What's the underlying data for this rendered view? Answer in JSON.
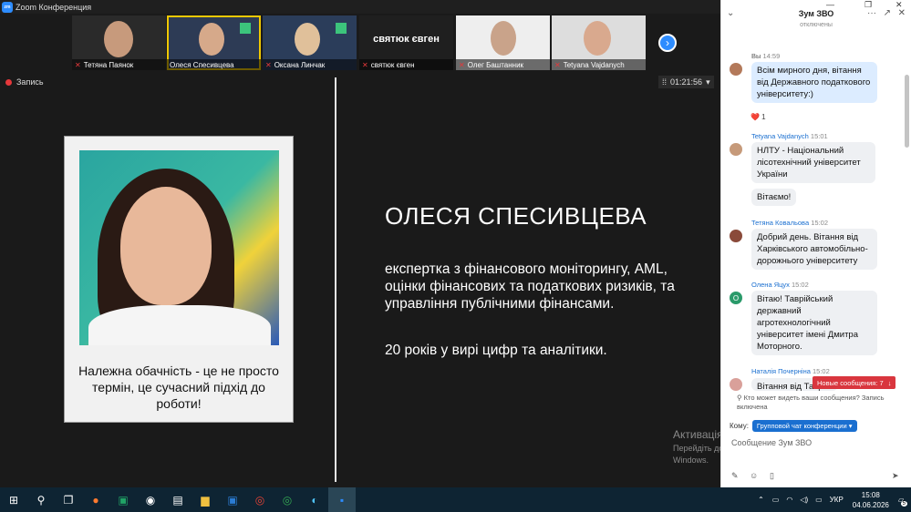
{
  "window": {
    "title": "Zoom Конференция",
    "logo": "zm"
  },
  "participants": [
    {
      "name": "Тетяна Паянок",
      "muted": true
    },
    {
      "name": "Олеся Спесивцева",
      "muted": false,
      "active": true
    },
    {
      "name": "Оксана Линчак",
      "muted": true
    },
    {
      "name": "святюк євген",
      "muted": true,
      "display_name": "святюк євген"
    },
    {
      "name": "Олег Баштанник",
      "muted": true
    },
    {
      "name": "Tetyana Vajdanych",
      "muted": true
    }
  ],
  "toolbar": {
    "record_label": "Запись",
    "timer": "01:21:56"
  },
  "slide": {
    "quote": "Належна обачність - це не просто термін, це сучасний підхід до роботи!",
    "name": "ОЛЕСЯ СПЕСИВЦЕВА",
    "bio": "експертка з фінансового моніторингу, AML, оцінки фінансових та податкових ризиків, та управління публічними фінансами.",
    "years": "20 років у вирі цифр та аналітики."
  },
  "watermark": {
    "title": "Активація Windows",
    "text": "Перейдіть до розділу \"Настройки\", щоб активувати Windows."
  },
  "chat": {
    "title": "Зум ЗВО",
    "subtitle": "отключены",
    "messages": [
      {
        "sender": "Вы",
        "time": "14:59",
        "text": "Всім мирного дня, вітання від Державного податкового університету:)",
        "mine": true,
        "reaction": "❤️ 1"
      },
      {
        "sender": "Tetyana Vajdanych",
        "time": "15:01",
        "text": "НЛТУ - Національний лісотехнічний університет України",
        "extra": "Вітаємо!"
      },
      {
        "sender": "Тетяна Ковальова",
        "time": "15:02",
        "text": "Добрий день. Вітання від Харківського автомобільно-дорожнього університету"
      },
      {
        "sender": "Олена Яцух",
        "time": "15:02",
        "text": "Вітаю! Таврійський державний агротехнологічний університет імені Дмитра Моторного.",
        "initial": "О"
      },
      {
        "sender": "Наталія Почерніна",
        "time": "15:02",
        "text": "Вітання від Таврі..."
      }
    ],
    "new_messages": "Новые сообщения: 7",
    "who_sees": "Кто может видеть ваши сообщения? Запись включена",
    "to_label": "Кому:",
    "to_value": "Групповой чат конференции",
    "input_placeholder": "Сообщение Зум ЗВО"
  },
  "taskbar": {
    "language": "УКР",
    "time": "15:08",
    "date": "04.06.2026",
    "notifications": "5"
  }
}
